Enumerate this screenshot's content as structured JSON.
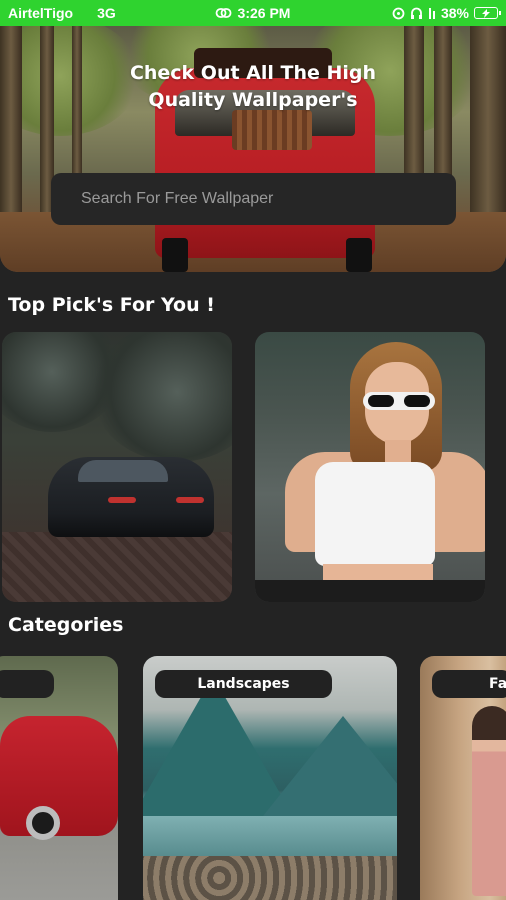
{
  "status_bar": {
    "carrier": "AirtelTigo",
    "network": "3G",
    "time": "3:26 PM",
    "battery": "38%"
  },
  "hero": {
    "title_line1": "Check Out All The High",
    "title_line2": "Quality Wallpaper's",
    "search_placeholder": "Search For Free Wallpaper"
  },
  "top_picks": {
    "title": "Top Pick's For You !",
    "items": [
      {
        "name": "black-sports-car-wallpaper"
      },
      {
        "name": "woman-sunglasses-wallpaper"
      }
    ]
  },
  "categories": {
    "title": "Categories",
    "items": [
      {
        "label": "",
        "image": "red-car"
      },
      {
        "label": "Landscapes",
        "image": "mountain-lake"
      },
      {
        "label": "Fa",
        "image": "fashion"
      }
    ]
  },
  "colors": {
    "status_bar": "#2fd32f",
    "background": "#232323",
    "search_box": "#262626"
  }
}
